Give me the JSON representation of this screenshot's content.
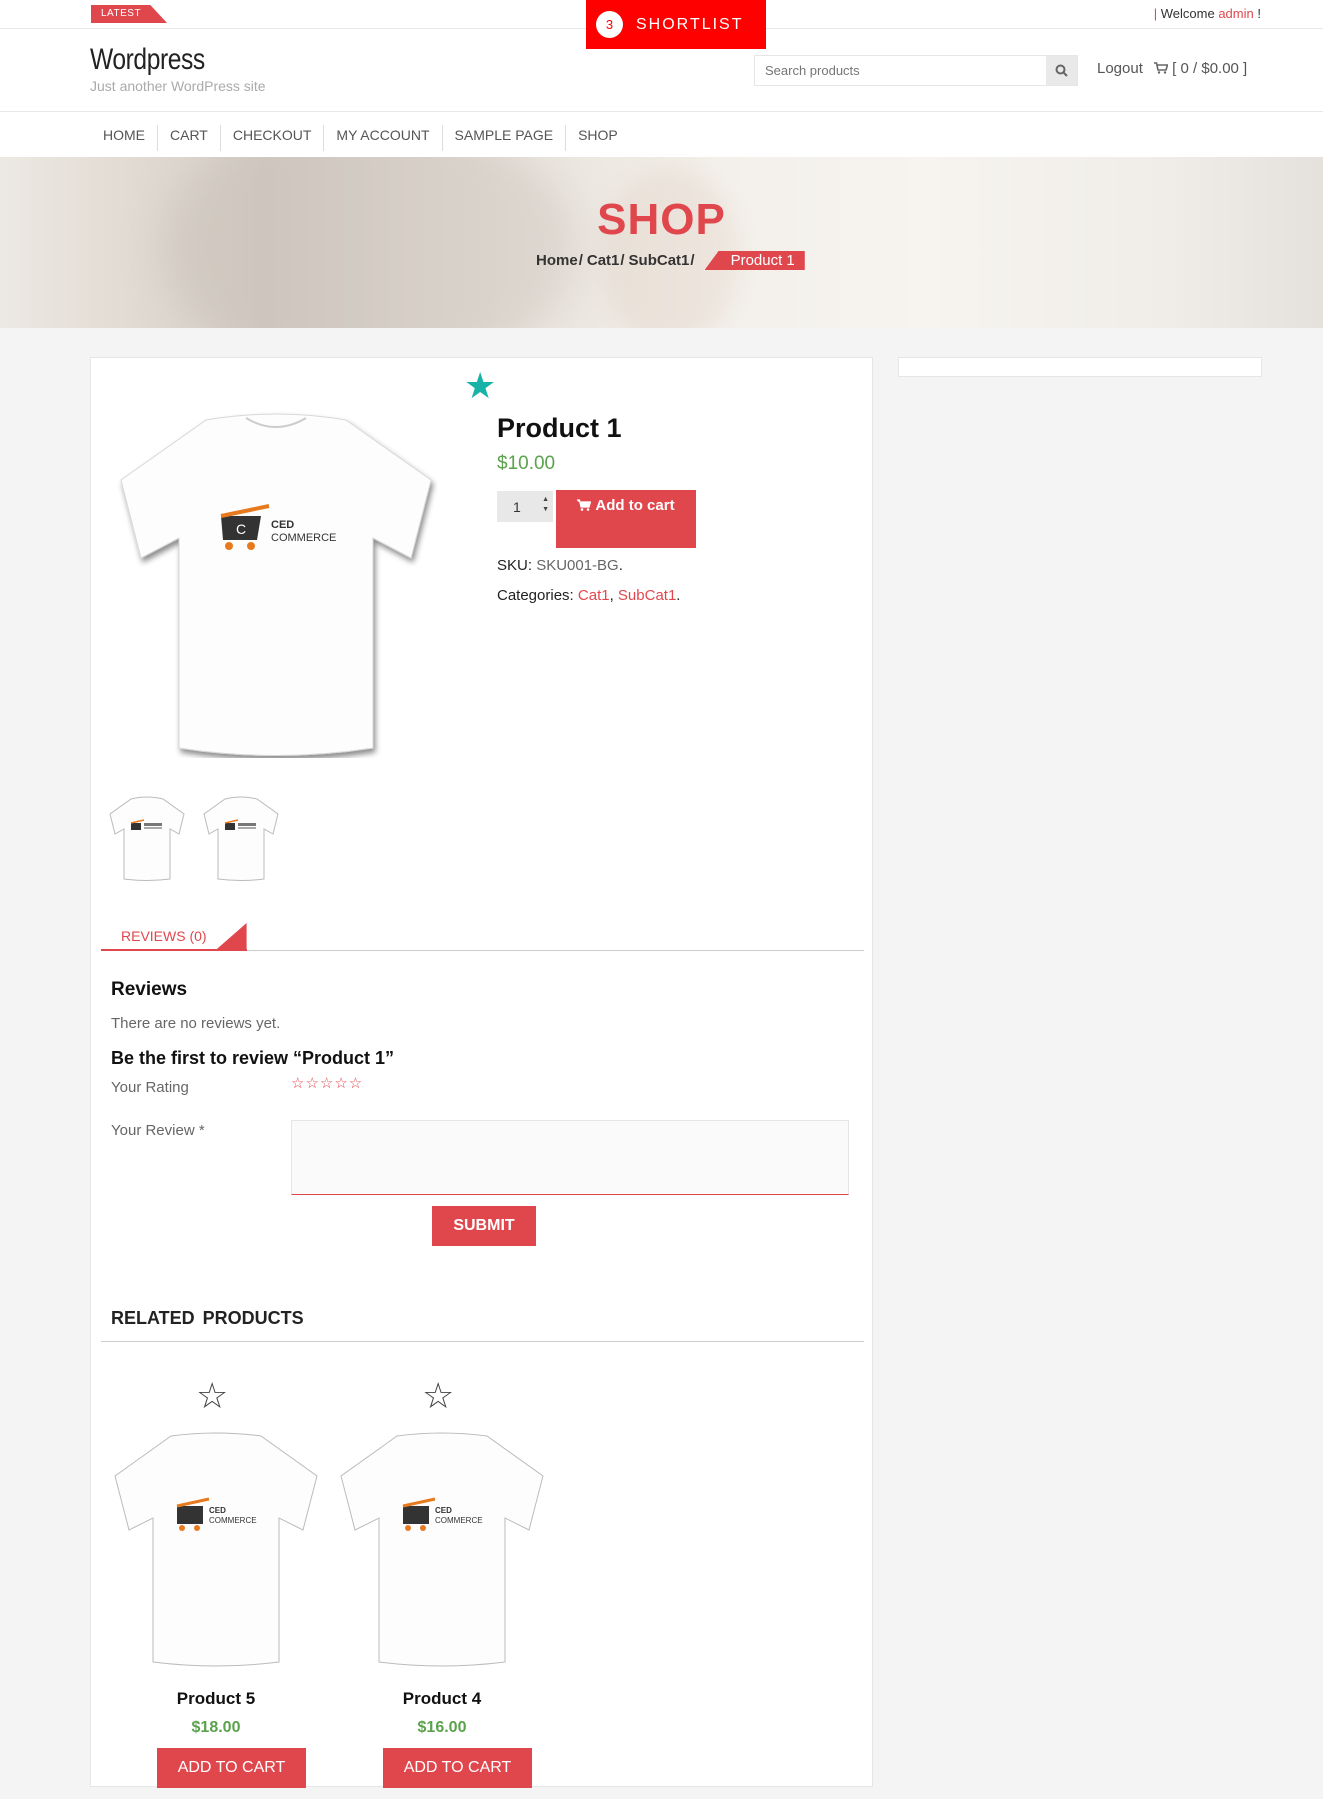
{
  "topbar": {
    "latest": "LATEST",
    "welcome_sep": "|",
    "welcome_prefix": "Welcome",
    "username": "admin",
    "welcome_suffix": "!"
  },
  "shortlist": {
    "count": "3",
    "label": "SHORTLIST"
  },
  "header": {
    "site_title": "Wordpress",
    "tagline": "Just another WordPress site",
    "search_placeholder": "Search products",
    "logout": "Logout",
    "cart_summary": "[ 0 / $0.00 ]"
  },
  "nav": {
    "items": [
      "HOME",
      "CART",
      "CHECKOUT",
      "MY ACCOUNT",
      "SAMPLE PAGE",
      "SHOP"
    ]
  },
  "banner": {
    "title": "SHOP",
    "breadcrumb": [
      "Home",
      "Cat1",
      "SubCat1"
    ],
    "breadcrumb_sep": "/",
    "current": "Product 1"
  },
  "product": {
    "title": "Product 1",
    "price": "$10.00",
    "quantity": "1",
    "add_to_cart": "Add to cart",
    "sku_label": "SKU:",
    "sku_value": "SKU001-BG",
    "categories_label": "Categories:",
    "categories": [
      "Cat1",
      "SubCat1"
    ],
    "logo_text_1": "CED",
    "logo_text_2": "COMMERCE"
  },
  "tabs": {
    "reviews": "REVIEWS (0)"
  },
  "reviews": {
    "heading": "Reviews",
    "empty": "There are no reviews yet.",
    "first_review": "Be the first to review “Product 1”",
    "rating_label": "Your Rating",
    "review_label": "Your Review *",
    "submit": "SUBMIT"
  },
  "related": {
    "heading": "RELATED PRODUCTS",
    "items": [
      {
        "name": "Product 5",
        "price": "$18.00",
        "button": "ADD TO CART"
      },
      {
        "name": "Product 4",
        "price": "$16.00",
        "button": "ADD TO CART"
      }
    ]
  },
  "colors": {
    "accent": "#e0474d",
    "price_green": "#5aa24c",
    "shortlist_red": "#ff0000",
    "favorite_teal": "#16b3a6"
  }
}
